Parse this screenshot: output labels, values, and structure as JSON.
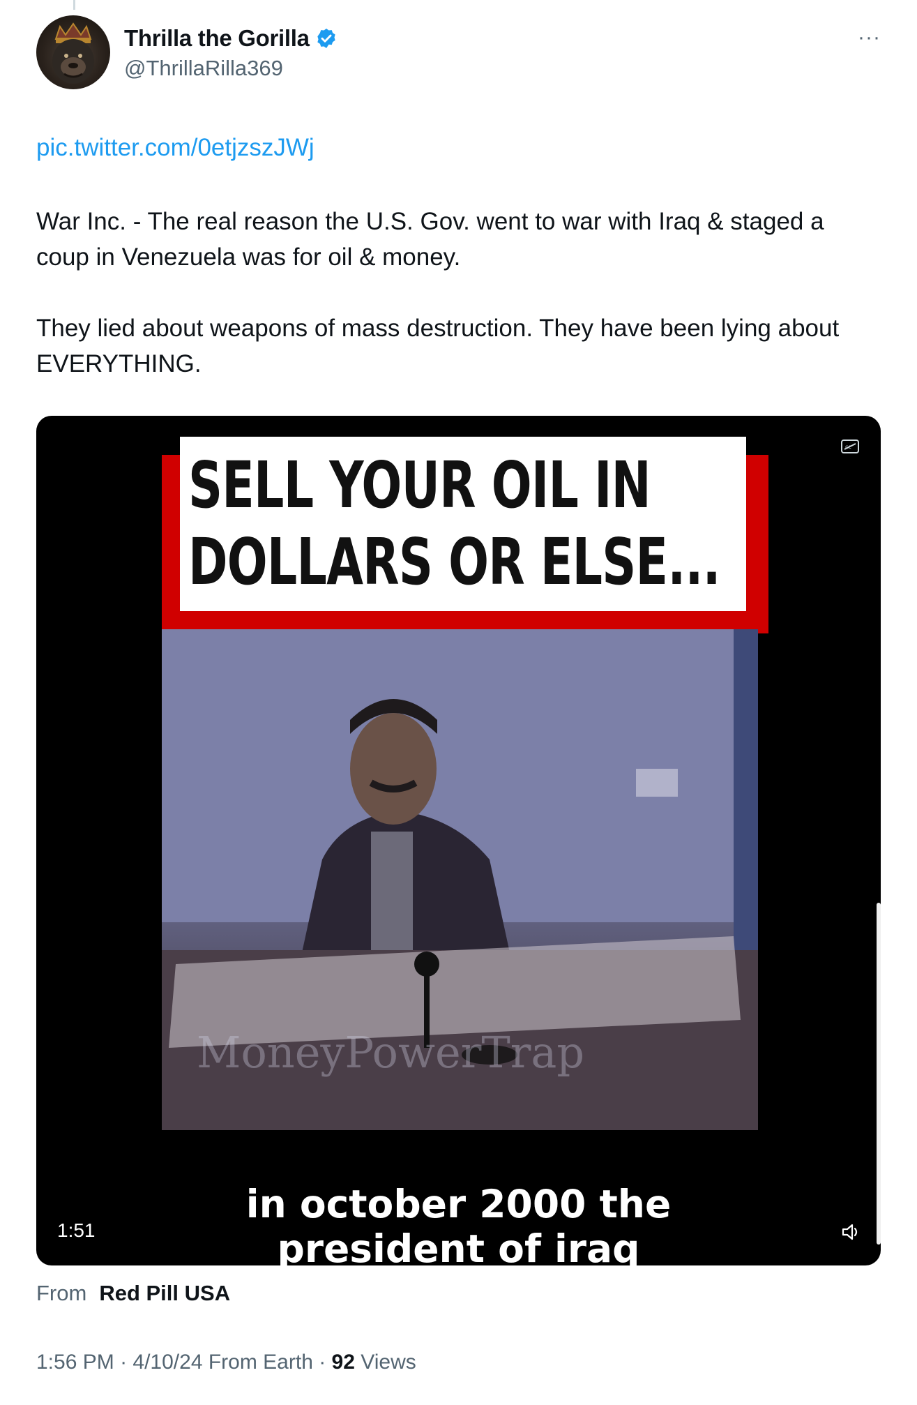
{
  "author": {
    "name": "Thrilla the Gorilla",
    "handle": "@ThrillaRilla369",
    "verified": true,
    "avatar_icon": "gorilla-king-avatar",
    "more_label": "···"
  },
  "tweet": {
    "link": "pic.twitter.com/0etjzszJWj",
    "paragraphs": [
      "War Inc. - The real reason the U.S. Gov. went to war with Iraq & staged a coup in Venezuela was for oil & money.",
      "They lied about weapons of mass destruction. They have been lying about EVERYTHING."
    ]
  },
  "video": {
    "banner_line1": "SELL YOUR OIL IN",
    "banner_line2": "DOLLARS OR ELSE...",
    "watermark": "MoneyPowerTrap",
    "caption_line1": "in october 2000 the",
    "caption_line2": "president of iraq",
    "duration": "1:51",
    "banner_red": "#d00000"
  },
  "source": {
    "label": "From",
    "name": "Red Pill USA"
  },
  "meta": {
    "time": "1:56 PM",
    "date": "4/10/24",
    "location": "From Earth",
    "views_count": "92",
    "views_label": "Views"
  },
  "colors": {
    "link_blue": "#1d9bf0",
    "secondary_gray": "#536471",
    "verified_blue": "#1d9bf0"
  }
}
